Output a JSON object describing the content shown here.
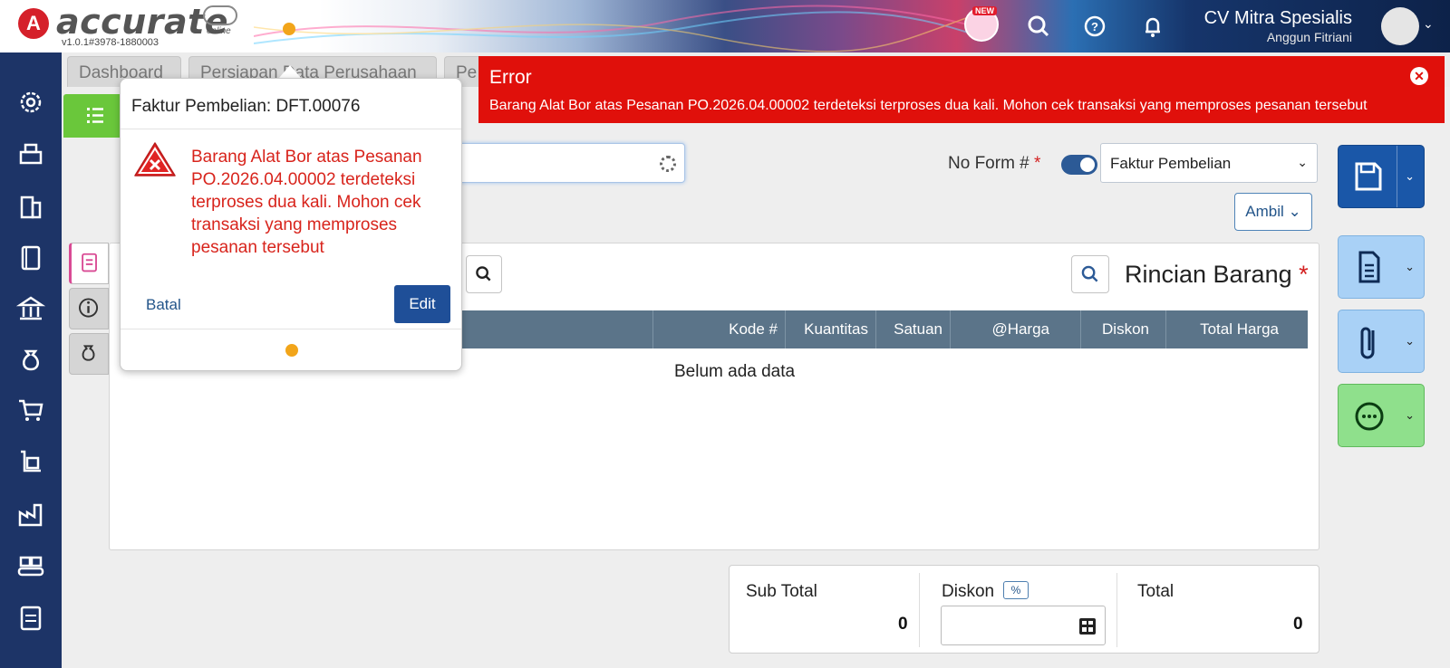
{
  "header": {
    "logo_letter": "A",
    "logo_text": "accurate",
    "logo_sub": "online",
    "version": "v1.0.1#3978-1880003",
    "new_badge": "NEW",
    "company": "CV Mitra Spesialis",
    "user": "Anggun Fitriani"
  },
  "tabs": [
    {
      "label": "Dashboard"
    },
    {
      "label": "Persiapan Data Perusahaan"
    },
    {
      "label": "Pe"
    }
  ],
  "form": {
    "no_form_label": "No Form #",
    "required_mark": "*",
    "form_type": "Faktur Pembelian",
    "ambil_label": "Ambil",
    "section_title": "Rincian Barang"
  },
  "grid": {
    "columns": [
      "Kode #",
      "Kuantitas",
      "Satuan",
      "@Harga",
      "Diskon",
      "Total Harga"
    ],
    "empty_text": "Belum ada data"
  },
  "totals": {
    "subtotal_label": "Sub Total",
    "subtotal_value": "0",
    "discount_label": "Diskon",
    "discount_unit": "%",
    "total_label": "Total",
    "total_value": "0"
  },
  "error_banner": {
    "title": "Error",
    "message": "Barang Alat Bor atas Pesanan PO.2026.04.00002 terdeteksi terproses dua kali. Mohon cek transaksi yang memproses pesanan tersebut"
  },
  "popover": {
    "title": "Faktur Pembelian: DFT.00076",
    "message": "Barang Alat Bor atas Pesanan PO.2026.04.00002 terdeteksi terproses dua kali. Mohon cek transaksi yang memproses pesanan tersebut",
    "cancel_label": "Batal",
    "edit_label": "Edit"
  },
  "colors": {
    "sidebar": "#1d3467",
    "error": "#e0100b",
    "primary": "#1f4f98",
    "accent_green": "#6ac73b",
    "status_dot": "#f2a51a"
  },
  "icons": {
    "sidebar": [
      "gear-icon",
      "printer-icon",
      "building-icon",
      "book-icon",
      "bank-icon",
      "money-bag-icon",
      "cart-icon",
      "hand-truck-icon",
      "factory-icon",
      "conveyor-icon",
      "tax-icon"
    ]
  }
}
